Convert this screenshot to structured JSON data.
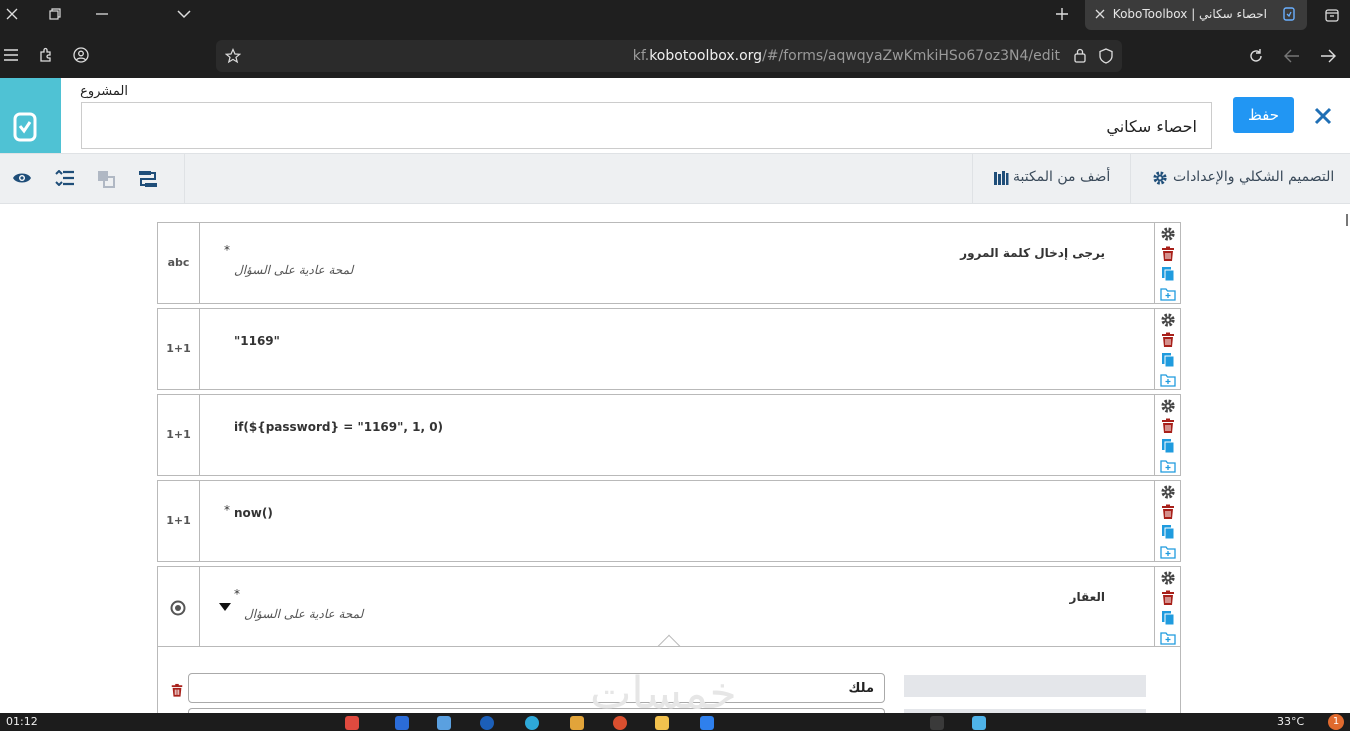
{
  "browser": {
    "tab_title": "احصاء سكاني | KoboToolbox",
    "url_domain": "kobotoolbox.org",
    "url_prefix": "kf.",
    "url_path": "/#/forms/aqwqyaZwKmkiHSo67oz3N4/edit"
  },
  "header": {
    "project_label": "المشروع",
    "project_name": "احصاء سكاني",
    "save_label": "حفظ"
  },
  "toolbar": {
    "settings_label": "التصميم الشكلي والإعدادات",
    "library_label": "أضف من المكتبة"
  },
  "questions": [
    {
      "type": "abc",
      "label": "يرجى إدخال كلمة المرور",
      "hint": "لمحة عادية على السؤال",
      "required": "*"
    },
    {
      "type": "1+1",
      "calc": "\"1169\""
    },
    {
      "type": "1+1",
      "calc": "if(${password} = \"1169\", 1, 0)"
    },
    {
      "type": "1+1",
      "calc": "now()",
      "required": "*"
    },
    {
      "type": "select",
      "label": "العقار",
      "hint": "لمحة عادية على السؤال",
      "required": "*"
    }
  ],
  "choices": [
    {
      "label": "ملك",
      "value": ""
    }
  ],
  "watermark": "خمسات",
  "taskbar": {
    "clock": "01:12",
    "temperature": "33°C",
    "notification_count": "1"
  },
  "colors": {
    "accent": "#2196f3",
    "logo_bg": "#4fc2d4",
    "delete": "#a8201a",
    "copy": "#1f9bde"
  }
}
